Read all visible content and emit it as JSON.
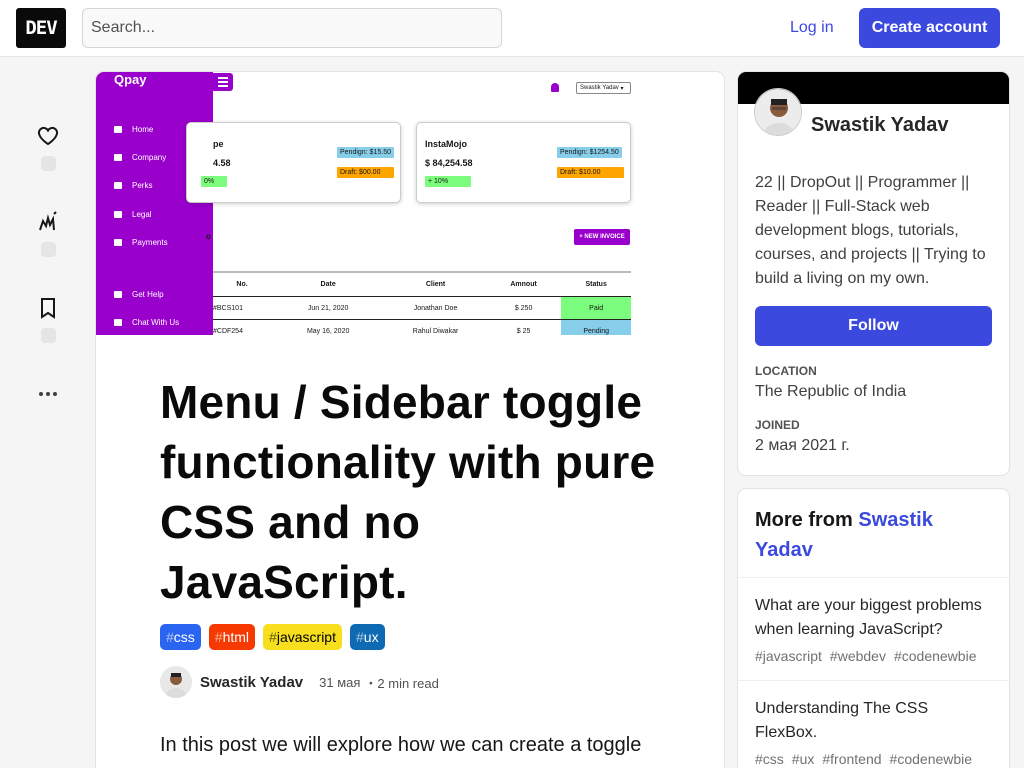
{
  "header": {
    "logo_text": "DEV",
    "search_placeholder": "Search...",
    "login_label": "Log in",
    "create_account_label": "Create account"
  },
  "colors": {
    "accent": "#3b49df",
    "purple": "#9900cc"
  },
  "reactions": [
    {
      "icon": "heart-icon",
      "count": ""
    },
    {
      "icon": "unicorn-icon",
      "count": ""
    },
    {
      "icon": "bookmark-icon",
      "count": ""
    },
    {
      "icon": "more-icon",
      "count": ""
    }
  ],
  "cover": {
    "brand": "Qpay",
    "menu": [
      "Home",
      "Company",
      "Perks",
      "Legal",
      "Payments"
    ],
    "menu_bottom": [
      "Get Help",
      "Chat With Us"
    ],
    "user_select": "Swastik Yadav",
    "card1": {
      "title": "pe",
      "amount": "4.58",
      "pending": "Pendign: $15.50",
      "draft": "Draft: $00.00",
      "change": "0%"
    },
    "card2": {
      "title": "InstaMojo",
      "amount": "$ 84,254.58",
      "pending": "Pendign: $1254.50",
      "draft": "Draft: $10.00",
      "change": "+ 10%"
    },
    "section_title": "o",
    "new_invoice": "+ NEW INVOICE",
    "table": {
      "columns": [
        "No.",
        "Date",
        "Client",
        "Amnout",
        "Status"
      ],
      "rows": [
        [
          "#BCS101",
          "Jun 21, 2020",
          "Jonathan Doe",
          "$ 250",
          "Paid"
        ],
        [
          "#CDF254",
          "May 16, 2020",
          "Rahul Diwakar",
          "$ 25",
          "Pending"
        ]
      ]
    }
  },
  "article": {
    "title": "Menu / Sidebar toggle functionality with pure CSS and no JavaScript.",
    "tags": [
      {
        "name": "css",
        "bg": "#2965f1",
        "fg": "#ffffff"
      },
      {
        "name": "html",
        "bg": "#f53900",
        "fg": "#ffffff"
      },
      {
        "name": "javascript",
        "bg": "#f7df1e",
        "fg": "#000000"
      },
      {
        "name": "ux",
        "bg": "#0f6ab4",
        "fg": "#ffffff"
      }
    ],
    "author": "Swastik Yadav",
    "date": "31 мая",
    "read_time": "・2 min read",
    "intro": "In this post we will explore how we can create a toggle"
  },
  "profile": {
    "name": "Swastik Yadav",
    "bio": "22 || DropOut || Programmer || Reader || Full-Stack web development blogs, tutorials, courses, and projects || Trying to build a living on my own.",
    "follow_label": "Follow",
    "location_label": "LOCATION",
    "location": "The Republic of India",
    "joined_label": "JOINED",
    "joined": "2 мая 2021 г."
  },
  "more_from": {
    "prefix": "More from",
    "author": "Swastik Yadav",
    "items": [
      {
        "title": "What are your biggest problems when learning JavaScript?",
        "tags": [
          "#javascript",
          "#webdev",
          "#codenewbie"
        ]
      },
      {
        "title": "Understanding The CSS FlexBox.",
        "tags": [
          "#css",
          "#ux",
          "#frontend",
          "#codenewbie"
        ]
      }
    ]
  }
}
